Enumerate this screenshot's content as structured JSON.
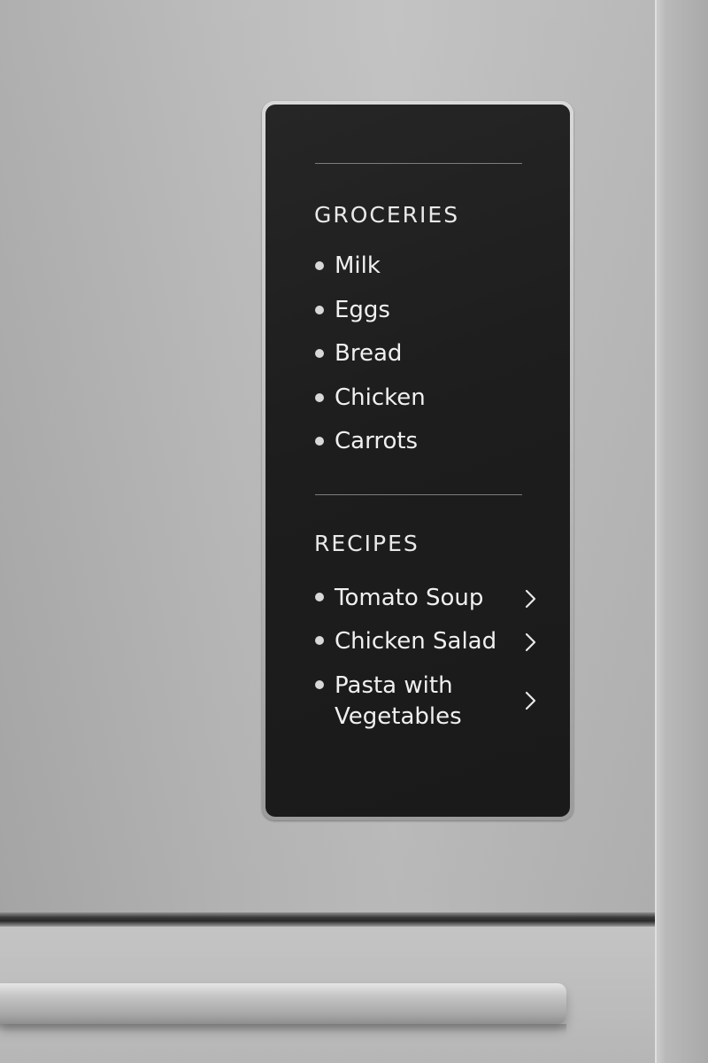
{
  "display": {
    "groceries": {
      "title": "GROCERIES",
      "items": [
        {
          "label": "Milk"
        },
        {
          "label": "Eggs"
        },
        {
          "label": "Bread"
        },
        {
          "label": "Chicken"
        },
        {
          "label": "Carrots"
        }
      ]
    },
    "recipes": {
      "title": "RECIPES",
      "items": [
        {
          "label": "Tomato Soup",
          "icon": "chevron-right-icon"
        },
        {
          "label": "Chicken Salad",
          "icon": "chevron-right-icon"
        },
        {
          "label": "Pasta with Vegetables",
          "icon": "chevron-right-icon"
        }
      ]
    }
  },
  "colors": {
    "screen_background": "#1e1e1e",
    "text": "#f0f0f0",
    "fridge_steel": "#b9b9b9"
  }
}
